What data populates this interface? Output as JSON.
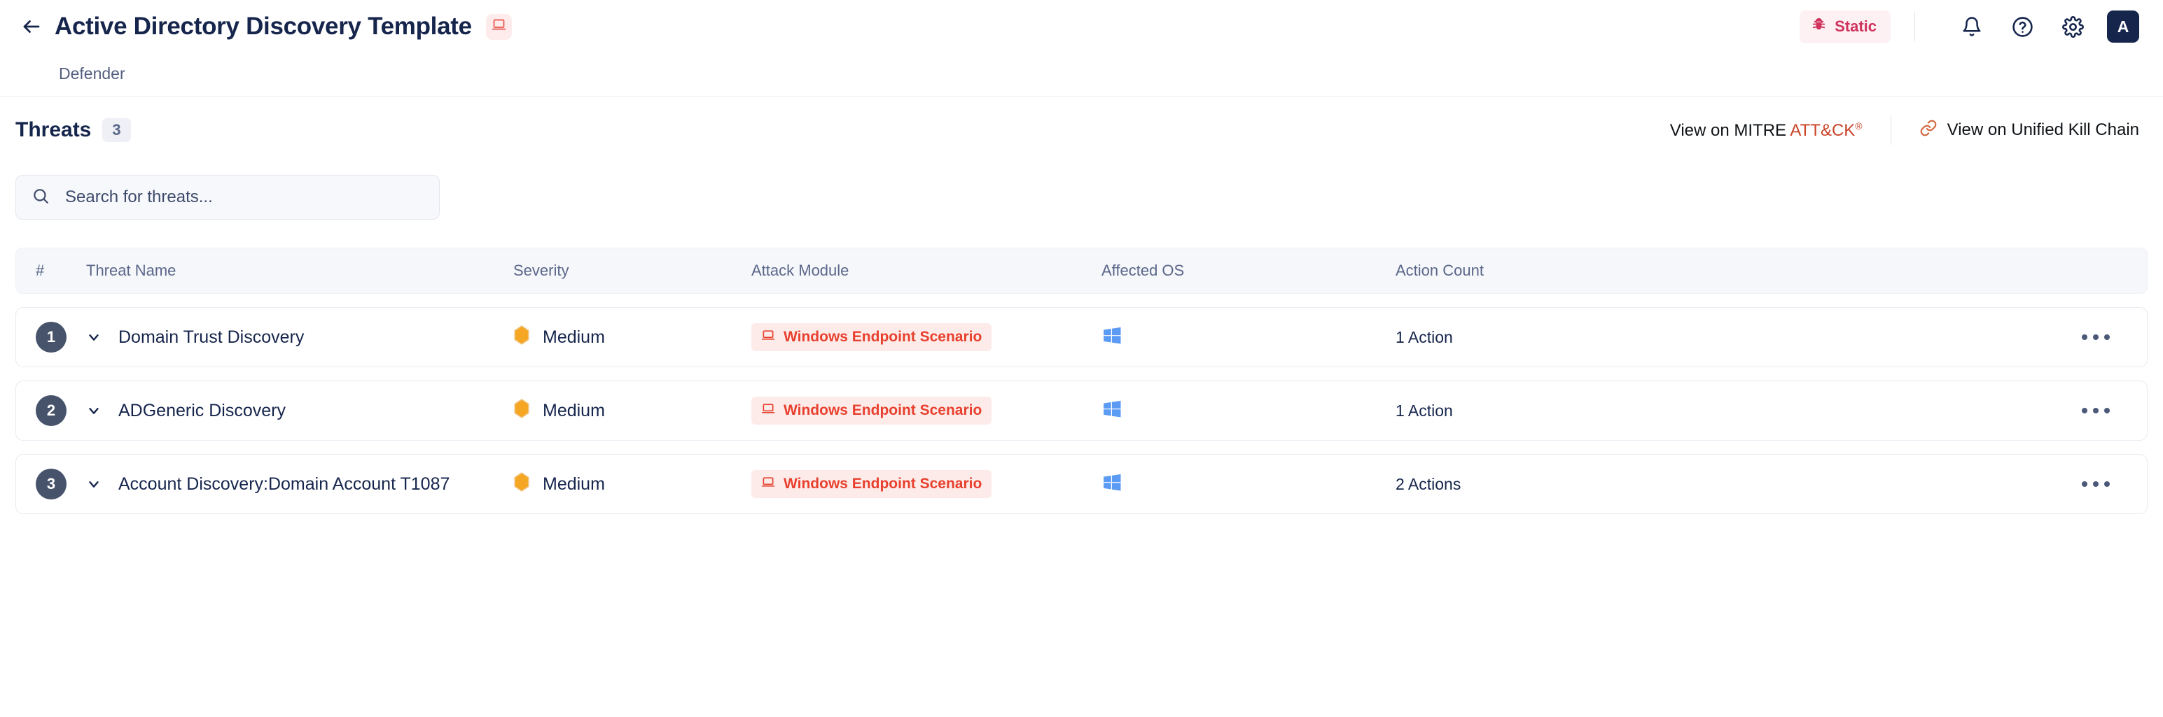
{
  "header": {
    "back_icon": "arrow-left-icon",
    "title": "Active Directory Discovery Template",
    "title_badge_icon": "laptop-icon",
    "static_badge": {
      "label": "Static",
      "icon": "bug-icon",
      "color": "#d0335c",
      "bg": "#fdf1f4"
    },
    "notification_icon": "bell-icon",
    "help_icon": "question-circle-icon",
    "settings_icon": "gear-icon",
    "avatar_label": "A"
  },
  "subnav": {
    "tabs": [
      {
        "label": "Defender"
      }
    ]
  },
  "section": {
    "title": "Threats",
    "count": "3",
    "mitre_link": {
      "prefix": "View on MITRE ",
      "highlight": "ATT&CK",
      "registered": "®",
      "color": "#c9452a"
    },
    "ukc_link": {
      "label": "View on Unified Kill Chain",
      "icon": "link-icon",
      "icon_color": "#d2663f"
    }
  },
  "search": {
    "placeholder": "Search for threats...",
    "value": "",
    "icon": "search-icon"
  },
  "table": {
    "columns": [
      "#",
      "Threat Name",
      "Severity",
      "Attack Module",
      "Affected OS",
      "Action Count"
    ],
    "rows": [
      {
        "num": "1",
        "name": "Domain Trust Discovery",
        "severity": "Medium",
        "severity_color": "#f5a623",
        "module": "Windows Endpoint Scenario",
        "module_icon": "laptop-icon",
        "os": "windows-icon",
        "actions": "1 Action",
        "menu_icon": "more-horizontal-icon",
        "chevron": "chevron-down-icon"
      },
      {
        "num": "2",
        "name": "ADGeneric Discovery",
        "severity": "Medium",
        "severity_color": "#f5a623",
        "module": "Windows Endpoint Scenario",
        "module_icon": "laptop-icon",
        "os": "windows-icon",
        "actions": "1 Action",
        "menu_icon": "more-horizontal-icon",
        "chevron": "chevron-down-icon"
      },
      {
        "num": "3",
        "name": "Account Discovery:Domain Account T1087",
        "severity": "Medium",
        "severity_color": "#f5a623",
        "module": "Windows Endpoint Scenario",
        "module_icon": "laptop-icon",
        "os": "windows-icon",
        "actions": "2 Actions",
        "menu_icon": "more-horizontal-icon",
        "chevron": "chevron-down-icon"
      }
    ]
  }
}
